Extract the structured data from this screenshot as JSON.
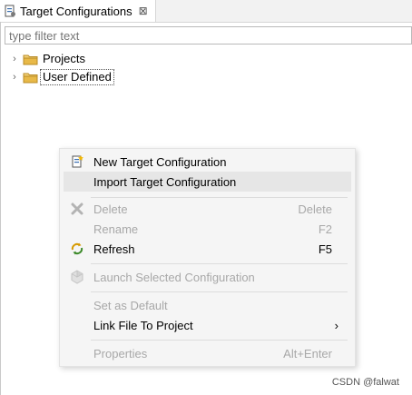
{
  "view": {
    "tab_title": "Target Configurations",
    "tab_icon": "target-config-icon",
    "close_glyph": "⊠"
  },
  "filter": {
    "value": "",
    "placeholder": "type filter text"
  },
  "tree": {
    "items": [
      {
        "label": "Projects",
        "icon": "folder-icon",
        "expanded": false
      },
      {
        "label": "User Defined",
        "icon": "folder-icon",
        "expanded": false,
        "selected": true
      }
    ]
  },
  "context_menu": {
    "items": [
      {
        "label": "New Target Configuration",
        "icon": "new-config-icon",
        "shortcut": "",
        "enabled": true
      },
      {
        "label": "Import Target Configuration",
        "icon": "",
        "shortcut": "",
        "enabled": true,
        "hover": true
      },
      {
        "label": "Delete",
        "icon": "delete-icon",
        "shortcut": "Delete",
        "enabled": false
      },
      {
        "label": "Rename",
        "icon": "",
        "shortcut": "F2",
        "enabled": false
      },
      {
        "label": "Refresh",
        "icon": "refresh-icon",
        "shortcut": "F5",
        "enabled": true
      },
      {
        "label": "Launch Selected Configuration",
        "icon": "launch-icon",
        "shortcut": "",
        "enabled": false
      },
      {
        "label": "Set as Default",
        "icon": "",
        "shortcut": "",
        "enabled": false
      },
      {
        "label": "Link File To Project",
        "icon": "",
        "shortcut": "",
        "enabled": true,
        "submenu": true
      },
      {
        "label": "Properties",
        "icon": "",
        "shortcut": "Alt+Enter",
        "enabled": false
      }
    ],
    "submenu_glyph": "›"
  },
  "watermark": "CSDN @falwat",
  "colors": {
    "menu_bg": "#f5f5f5",
    "hover_bg": "#e6e6e6",
    "disabled_text": "#a8a8a8",
    "folder": "#e8b948"
  }
}
